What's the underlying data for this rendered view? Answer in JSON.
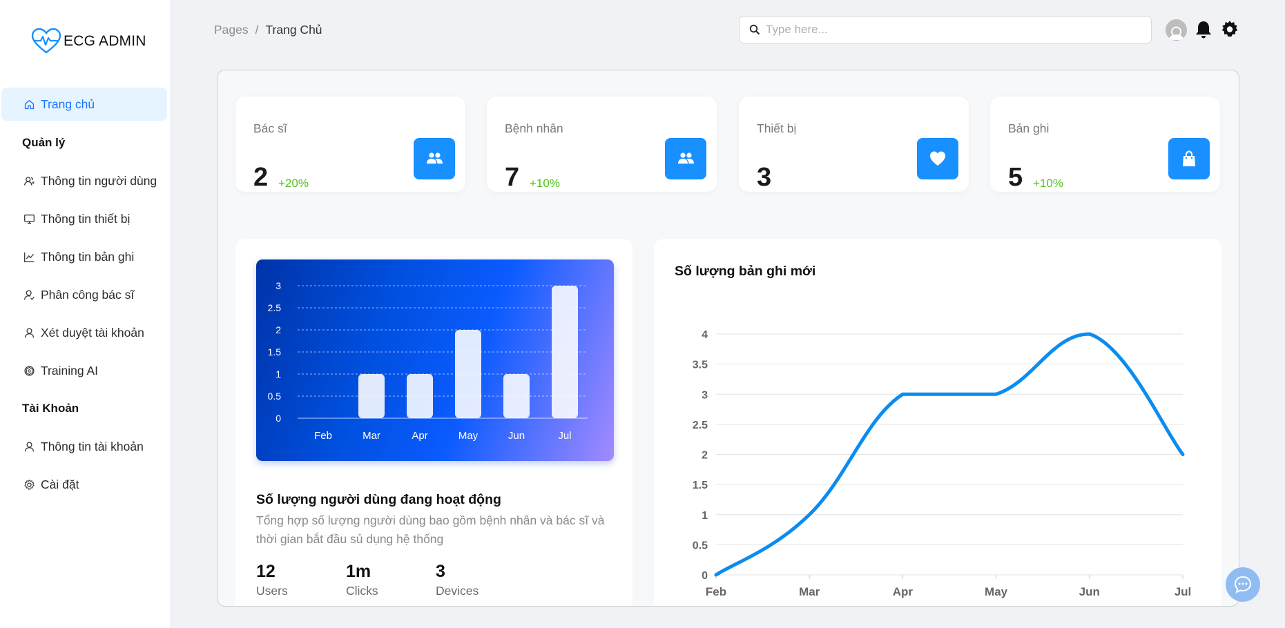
{
  "app": {
    "logo_text": "ECG ADMIN"
  },
  "sidebar": {
    "items": [
      {
        "label": "Trang chủ",
        "icon": "home-icon",
        "active": true
      },
      {
        "label": "Thông tin người dùng",
        "icon": "users-icon"
      },
      {
        "label": "Thông tin thiết bị",
        "icon": "desktop-icon"
      },
      {
        "label": "Thông tin bản ghi",
        "icon": "line-chart-icon"
      },
      {
        "label": "Phân công bác sĩ",
        "icon": "user-assign-icon"
      },
      {
        "label": "Xét duyệt tài khoản",
        "icon": "user-icon"
      },
      {
        "label": "Training AI",
        "icon": "openai-icon"
      },
      {
        "label": "Thông tin tài khoản",
        "icon": "user-icon"
      },
      {
        "label": "Cài đặt",
        "icon": "gear-icon"
      }
    ],
    "groups": {
      "manage": "Quản lý",
      "account": "Tài Khoản"
    }
  },
  "header": {
    "breadcrumb": {
      "root": "Pages",
      "separator": "/",
      "current": "Trang Chủ"
    },
    "search": {
      "placeholder": "Type here...",
      "value": ""
    }
  },
  "stats": [
    {
      "title": "Bác sĩ",
      "value": "2",
      "delta": "+20%",
      "icon": "team-icon"
    },
    {
      "title": "Bệnh nhân",
      "value": "7",
      "delta": "+10%",
      "icon": "team-icon"
    },
    {
      "title": "Thiết bị",
      "value": "3",
      "delta": "",
      "icon": "heart-icon"
    },
    {
      "title": "Bản ghi",
      "value": "5",
      "delta": "+10%",
      "icon": "shopping-bag-icon"
    }
  ],
  "active_users": {
    "title": "Số lượng người dùng đang hoạt động",
    "description": "Tổng hợp số lượng người dùng bao gồm bệnh nhân và bác sĩ và thời gian bắt đầu sủ dụng hệ thống",
    "metrics": [
      {
        "value": "12",
        "label": "Users"
      },
      {
        "value": "1m",
        "label": "Clicks"
      },
      {
        "value": "3",
        "label": "Devices"
      }
    ]
  },
  "new_records": {
    "title": "Số lượng bản ghi mới"
  },
  "colors": {
    "accent": "#1890ff",
    "positive": "#52c41a",
    "line": "#0a8cf0",
    "active_bg": "#e6f4ff"
  },
  "chart_data": [
    {
      "type": "bar",
      "categories": [
        "Feb",
        "Mar",
        "Apr",
        "May",
        "Jun",
        "Jul"
      ],
      "values": [
        0,
        1,
        1,
        2,
        1,
        3
      ],
      "ylim": [
        0,
        3
      ],
      "yticks": [
        0,
        0.5,
        1,
        1.5,
        2,
        2.5,
        3
      ],
      "grid": true
    },
    {
      "type": "line",
      "title": "Số lượng bản ghi mới",
      "categories": [
        "Feb",
        "Mar",
        "Apr",
        "May",
        "Jun",
        "Jul"
      ],
      "values": [
        0,
        1,
        3,
        3,
        4,
        2
      ],
      "ylim": [
        0,
        4
      ],
      "yticks": [
        0,
        0.5,
        1,
        1.5,
        2,
        2.5,
        3,
        3.5,
        4
      ],
      "grid": true
    }
  ]
}
